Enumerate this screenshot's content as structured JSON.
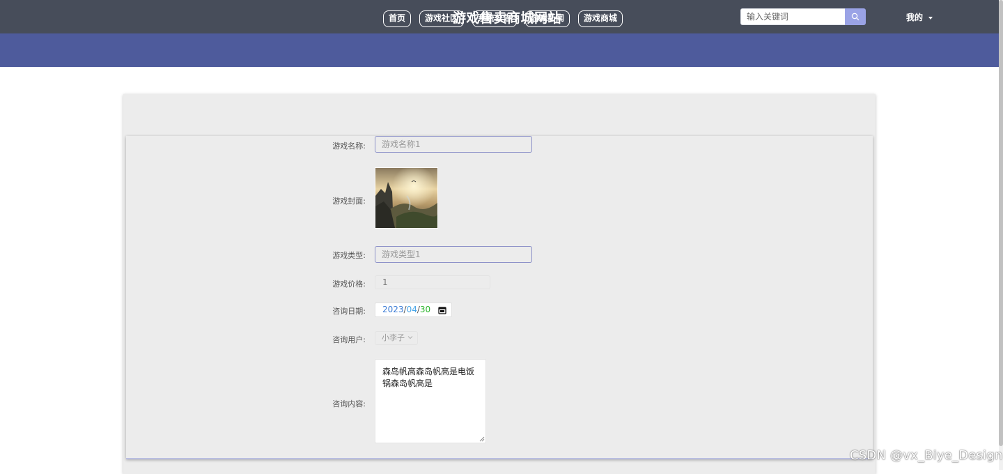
{
  "header": {
    "title": "游戏售卖商城网站",
    "search_placeholder": "输入关键词",
    "user_menu_label": "我的"
  },
  "nav": {
    "items": [
      {
        "label": "首页"
      },
      {
        "label": "游戏社区"
      },
      {
        "label": "系统公告"
      },
      {
        "label": "游戏新闻"
      },
      {
        "label": "游戏商城"
      }
    ]
  },
  "form": {
    "game_name": {
      "label": "游戏名称:",
      "placeholder": "游戏名称1"
    },
    "game_cover": {
      "label": "游戏封面:"
    },
    "game_type": {
      "label": "游戏类型:",
      "placeholder": "游戏类型1"
    },
    "game_price": {
      "label": "游戏价格:",
      "value": "1"
    },
    "consult_date": {
      "label": "咨询日期:",
      "year": "2023",
      "month": "04",
      "day": "30",
      "sep": "/"
    },
    "consult_user": {
      "label": "咨询用户:",
      "value": "小李子"
    },
    "consult_content": {
      "label": "咨询内容:",
      "value": "森岛帆高森岛帆高是电饭锅森岛帆高是"
    }
  },
  "watermark": "CSDN @vx_Biye_Design",
  "colors": {
    "topbar": "#474d5a",
    "navbar": "#4e5b9c",
    "search_button": "#9aa3e6",
    "panel": "#ececec",
    "field_border": "#8c91c8"
  }
}
